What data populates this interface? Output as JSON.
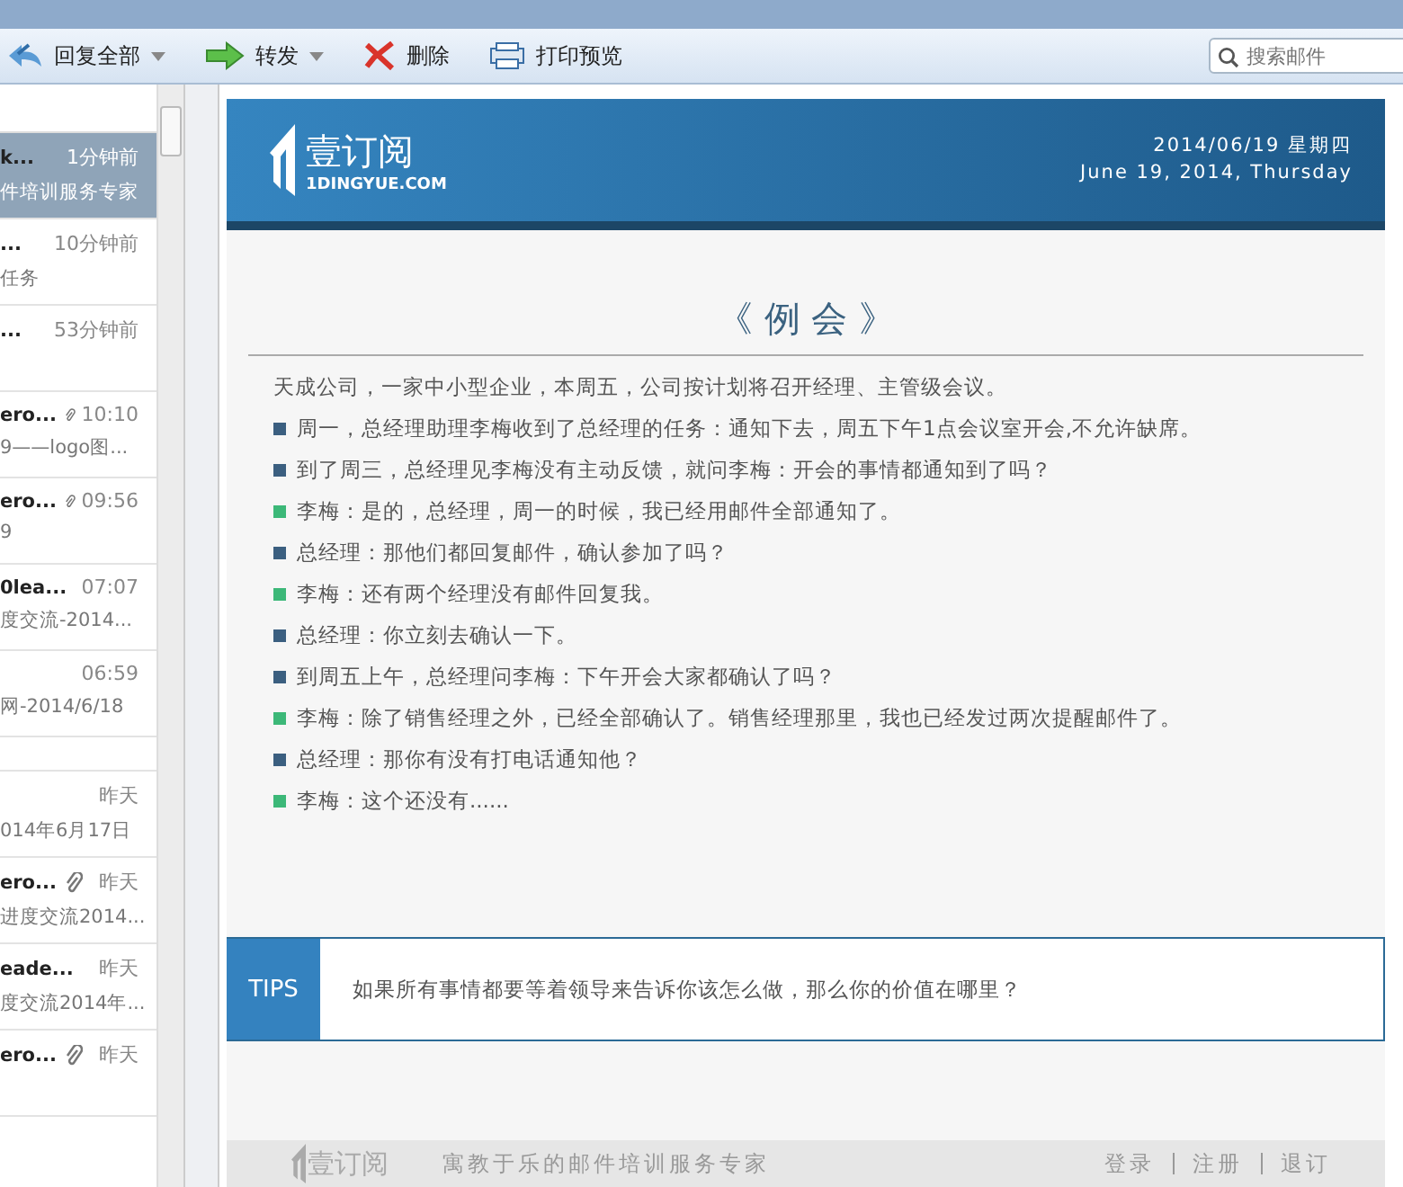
{
  "toolbar": {
    "buttons": [
      {
        "kind": "reply-all",
        "label": "回复全部",
        "dropdown": true
      },
      {
        "kind": "forward",
        "label": "转发",
        "dropdown": true
      },
      {
        "kind": "delete",
        "label": "删除",
        "dropdown": false
      },
      {
        "kind": "print",
        "label": "打印预览",
        "dropdown": false
      }
    ],
    "search": {
      "placeholder": "搜索邮件"
    }
  },
  "mail_list": [
    {
      "kind": "mail",
      "sender": "k...",
      "time": "1分钟前",
      "preview": "件培训服务专家",
      "attachment": false,
      "selected": true
    },
    {
      "kind": "mail",
      "sender": "...",
      "time": "10分钟前",
      "preview": "任务",
      "attachment": false,
      "selected": false
    },
    {
      "kind": "mail",
      "sender": "...",
      "time": "53分钟前",
      "attachment": false,
      "selected": false
    },
    {
      "kind": "mail",
      "sender": "ero...",
      "time": "10:10",
      "preview": "9——logo图...",
      "attachment": true,
      "selected": false
    },
    {
      "kind": "mail",
      "sender": "ero...",
      "time": "09:56",
      "preview": "9",
      "attachment": true,
      "selected": false
    },
    {
      "kind": "mail",
      "sender": "0lea...",
      "time": "07:07",
      "preview": "度交流-2014...",
      "attachment": false,
      "selected": false
    },
    {
      "kind": "mail",
      "time": "06:59",
      "preview": "网-2014/6/18",
      "attachment": false,
      "selected": false
    },
    {
      "kind": "group"
    },
    {
      "kind": "mail",
      "time": "昨天",
      "preview": "014年6月17日",
      "attachment": false,
      "selected": false
    },
    {
      "kind": "mail",
      "sender": "ero...",
      "time": "昨天",
      "preview": "进度交流2014...",
      "attachment": true,
      "selected": false
    },
    {
      "kind": "mail",
      "sender": "eade...",
      "time": "昨天",
      "preview": "度交流2014年...",
      "attachment": false,
      "selected": false
    },
    {
      "kind": "mail",
      "sender": "ero...",
      "time": "昨天",
      "attachment": true,
      "selected": false
    }
  ],
  "email": {
    "header": {
      "logo_text": "壹订阅",
      "logo_domain": "1DINGYUE.COM",
      "date_cn": "2014/06/19 星期四",
      "date_en": "June 19, 2014, Thursday"
    },
    "title": "《 例 会 》",
    "intro": "天成公司，一家中小型企业，本周五，公司按计划将召开经理、主管级会议。",
    "lines": [
      {
        "text": "周一，总经理助理李梅收到了总经理的任务：通知下去，周五下午1点会议室开会,不允许缺席。",
        "color": "#3b5f80"
      },
      {
        "text": "到了周三，总经理见李梅没有主动反馈，就问李梅：开会的事情都通知到了吗？",
        "color": "#3b5f80"
      },
      {
        "text": "李梅：是的，总经理，周一的时候，我已经用邮件全部通知了。",
        "color": "#3cb878"
      },
      {
        "text": "总经理：那他们都回复邮件，确认参加了吗？",
        "color": "#3b5f80"
      },
      {
        "text": "李梅：还有两个经理没有邮件回复我。",
        "color": "#3cb878"
      },
      {
        "text": "总经理：你立刻去确认一下。",
        "color": "#3b5f80"
      },
      {
        "text": "到周五上午，总经理问李梅：下午开会大家都确认了吗？",
        "color": "#3b5f80"
      },
      {
        "text": "李梅：除了销售经理之外，已经全部确认了。销售经理那里，我也已经发过两次提醒邮件了。",
        "color": "#3cb878"
      },
      {
        "text": "总经理：那你有没有打电话通知他？",
        "color": "#3b5f80"
      },
      {
        "text": "李梅：这个还没有......",
        "color": "#3cb878"
      }
    ],
    "tips": {
      "label": "TIPS",
      "text": "如果所有事情都要等着领导来告诉你该怎么做，那么你的价值在哪里？"
    },
    "footer": {
      "logo_text": "壹订阅",
      "slogan": "寓教于乐的邮件培训服务专家",
      "links": [
        "登录",
        "注册",
        "退订"
      ]
    }
  }
}
